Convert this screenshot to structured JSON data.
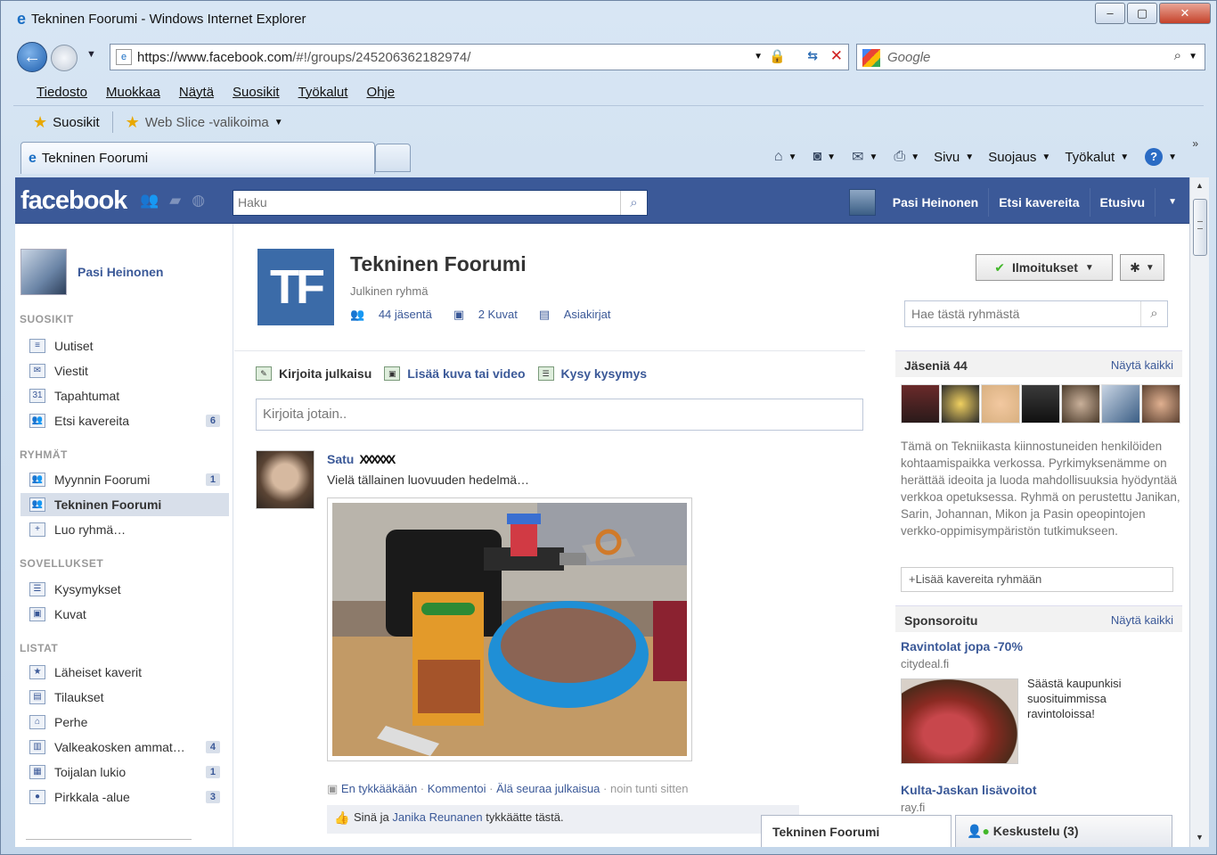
{
  "window": {
    "title": "Tekninen Foorumi - Windows Internet Explorer",
    "minimize": "‒",
    "maximize": "▢",
    "close": "✕"
  },
  "address": {
    "url_host": "https://www.facebook.com",
    "url_path": "/#!/groups/245206362182974/",
    "search_placeholder": "Google"
  },
  "menu": [
    "Tiedosto",
    "Muokkaa",
    "Näytä",
    "Suosikit",
    "Työkalut",
    "Ohje"
  ],
  "favorites": {
    "label": "Suosikit",
    "webslice": "Web Slice -valikoima"
  },
  "tab": {
    "label": "Tekninen Foorumi"
  },
  "commandbar": {
    "page": "Sivu",
    "safety": "Suojaus",
    "tools": "Työkalut"
  },
  "fb": {
    "logo": "facebook",
    "search_placeholder": "Haku",
    "nav": {
      "user": "Pasi Heinonen",
      "find_friends": "Etsi kavereita",
      "home": "Etusivu"
    }
  },
  "sidebar": {
    "profile_name": "Pasi Heinonen",
    "sections": {
      "favorites": "SUOSIKIT",
      "groups": "RYHMÄT",
      "apps": "SOVELLUKSET",
      "lists": "LISTAT"
    },
    "favorites": [
      {
        "label": "Uutiset",
        "count": ""
      },
      {
        "label": "Viestit",
        "count": ""
      },
      {
        "label": "Tapahtumat",
        "count": ""
      },
      {
        "label": "Etsi kavereita",
        "count": "6"
      }
    ],
    "groups": [
      {
        "label": "Myynnin Foorumi",
        "count": "1"
      },
      {
        "label": "Tekninen Foorumi",
        "count": ""
      },
      {
        "label": "Luo ryhmä…",
        "count": ""
      }
    ],
    "apps": [
      {
        "label": "Kysymykset",
        "count": ""
      },
      {
        "label": "Kuvat",
        "count": ""
      }
    ],
    "lists": [
      {
        "label": "Läheiset kaverit",
        "count": ""
      },
      {
        "label": "Tilaukset",
        "count": ""
      },
      {
        "label": "Perhe",
        "count": ""
      },
      {
        "label": "Valkeakosken ammat…",
        "count": "4"
      },
      {
        "label": "Toijalan lukio",
        "count": "1"
      },
      {
        "label": "Pirkkala -alue",
        "count": "3"
      }
    ]
  },
  "group": {
    "initials": "TF",
    "title": "Tekninen Foorumi",
    "type": "Julkinen ryhmä",
    "members_link": "44 jäsentä",
    "photos_link": "2 Kuvat",
    "docs_link": "Asiakirjat",
    "notify_button": "Ilmoitukset"
  },
  "composer": {
    "write": "Kirjoita julkaisu",
    "photo": "Lisää kuva tai video",
    "question": "Kysy kysymys",
    "placeholder": "Kirjoita jotain.."
  },
  "post": {
    "first_name": "Satu",
    "last_name": "XXXXXX",
    "text": "Vielä tällainen luovuuden hedelmä…",
    "meta": {
      "unlike": "En tykkääkään",
      "comment": "Kommentoi",
      "unfollow": "Älä seuraa julkaisua",
      "time": "noin tunti sitten"
    },
    "likes_prefix": "Sinä ja",
    "likes_name": "Janika Reunanen",
    "likes_suffix": "tykkäätte tästä."
  },
  "right": {
    "search_placeholder": "Hae tästä ryhmästä",
    "members_title": "Jäseniä 44",
    "see_all": "Näytä kaikki",
    "description": "Tämä on Tekniikasta kiinnostuneiden henkilöiden kohtaamispaikka verkossa. Pyrkimyksenämme on herättää ideoita ja luoda mahdollisuuksia hyödyntää verkkoa opetuksessa. Ryhmä on perustettu Janikan, Sarin, Johannan, Mikon ja Pasin opeopintojen verkko-oppimisympäristön tutkimukseen.",
    "add_friends": "Lisää kavereita ryhmään",
    "sponsored": "Sponsoroitu",
    "ad1": {
      "title": "Ravintolat jopa -70%",
      "domain": "citydeal.fi",
      "text": "Säästä kaupunkisi suosituimmissa ravintoloissa!"
    },
    "ad2": {
      "title": "Kulta-Jaskan lisävoitot",
      "domain": "ray.fi"
    }
  },
  "chat": {
    "tab": "Tekninen Foorumi",
    "chat_label": "Keskustelu (3)"
  },
  "colors": {
    "fb_blue": "#3b5998",
    "fb_link": "#3b5998",
    "ie_frame": "#c3d6ea"
  }
}
